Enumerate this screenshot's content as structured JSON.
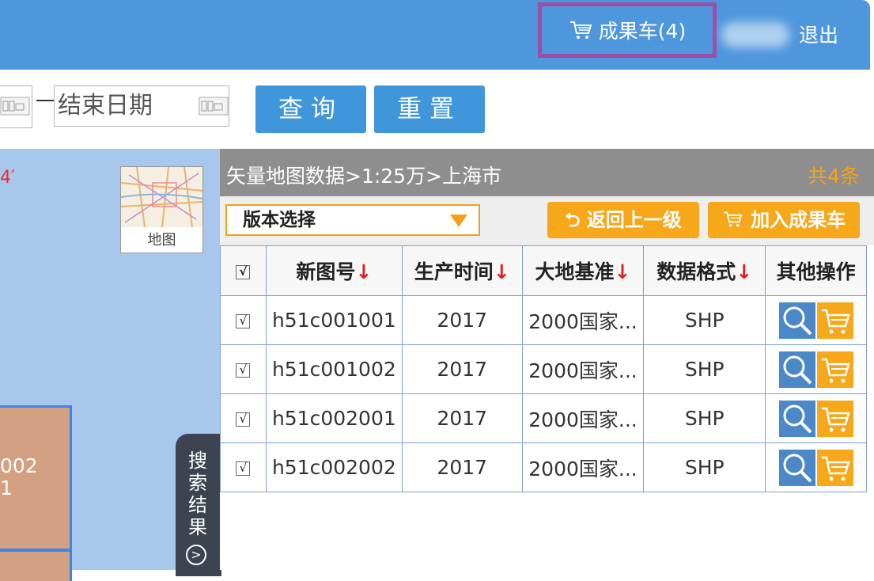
{
  "header": {
    "cart_label": "成果车(4)",
    "logout_label": "退出"
  },
  "search": {
    "end_date_placeholder": "结束日期",
    "dash": "一",
    "query_button": "查询",
    "reset_button": "重置"
  },
  "map": {
    "coord_text": "4′",
    "thumb_label": "地图",
    "tile_text_line1": "002",
    "tile_text_line2": "1",
    "results_tab_label": "搜索结果"
  },
  "panel": {
    "breadcrumb": "矢量地图数据>1:25万>上海市",
    "count": "共4条",
    "version_select": "版本选择",
    "back_button": "返回上一级",
    "add_cart_button": "加入成果车"
  },
  "table": {
    "check_header": "√",
    "columns": [
      "新图号",
      "生产时间",
      "大地基准",
      "数据格式",
      "其他操作"
    ],
    "sort_arrow": "↓",
    "rows": [
      {
        "check": "√",
        "id": "h51c001001",
        "year": "2017",
        "datum": "2000国家...",
        "format": "SHP"
      },
      {
        "check": "√",
        "id": "h51c001002",
        "year": "2017",
        "datum": "2000国家...",
        "format": "SHP"
      },
      {
        "check": "√",
        "id": "h51c002001",
        "year": "2017",
        "datum": "2000国家...",
        "format": "SHP"
      },
      {
        "check": "√",
        "id": "h51c002002",
        "year": "2017",
        "datum": "2000国家...",
        "format": "SHP"
      }
    ]
  },
  "icons": {
    "cart": "cart-icon",
    "search": "magnifier-icon",
    "calendar": "calendar-icon",
    "back": "return-arrow-icon",
    "chevron": "chevron-right-icon"
  },
  "colors": {
    "header_blue": "#4f97dd",
    "highlight_purple": "#9b4fa6",
    "orange": "#f7a71a",
    "button_blue": "#3f96da",
    "map_blue": "#a8c7ec",
    "sort_red": "#e02020"
  }
}
